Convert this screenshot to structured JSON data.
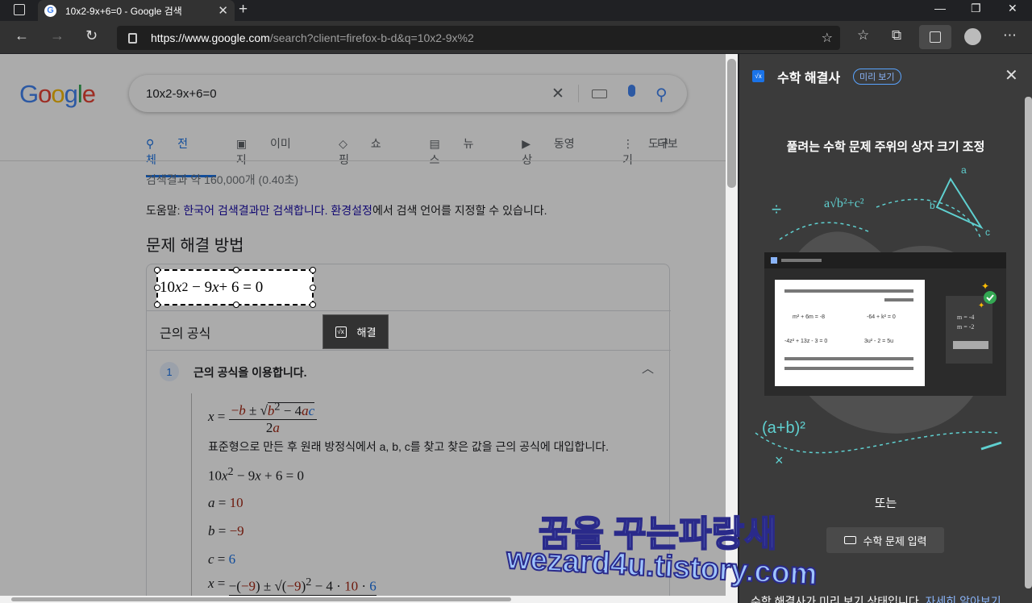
{
  "browser": {
    "tab_title": "10x2-9x+6=0 - Google 검색",
    "url_host": "https://www.google.com",
    "url_rest": "/search?client=firefox-b-d&q=10x2-9x%2"
  },
  "google": {
    "logo": "Google",
    "query": "10x2-9x+6=0",
    "tabs": [
      "전체",
      "이미지",
      "쇼핑",
      "뉴스",
      "동영상",
      "더보기"
    ],
    "tools": "도구",
    "stats": "검색결과 약 160,000개 (0.40초)",
    "tip_prefix": "도움말: ",
    "tip_link1": "한국어",
    "tip_mid1": " 검색결과만 검색합니다. ",
    "tip_link2": "환경설정",
    "tip_rest": "에서 검색 언어를 지정할 수 있습니다.",
    "section_title": "문제 해결 방법",
    "method": "근의 공식",
    "step_number": "1",
    "step_title": "근의 공식을 이용합니다.",
    "step_desc": "표준형으로 만든 후 원래 방정식에서 a, b, c를 찾고 찾은 값을 근의 공식에 대입합니다."
  },
  "math": {
    "solve_label": "해결",
    "a": "10",
    "b": "−9",
    "c": "6"
  },
  "sidebar": {
    "title": "수학 해결사",
    "badge": "미리 보기",
    "heading": "풀려는 수학 문제 주위의 상자 크기 조정",
    "or": "또는",
    "input_button": "수학 문제 입력",
    "footer_text": "수학 해결사가 미리 보기 상태입니다. ",
    "footer_link": "자세히 알아보기"
  },
  "watermark": {
    "line1": "꿈을 꾸는파랑새",
    "line2": "wezard4u.tistory.com"
  }
}
